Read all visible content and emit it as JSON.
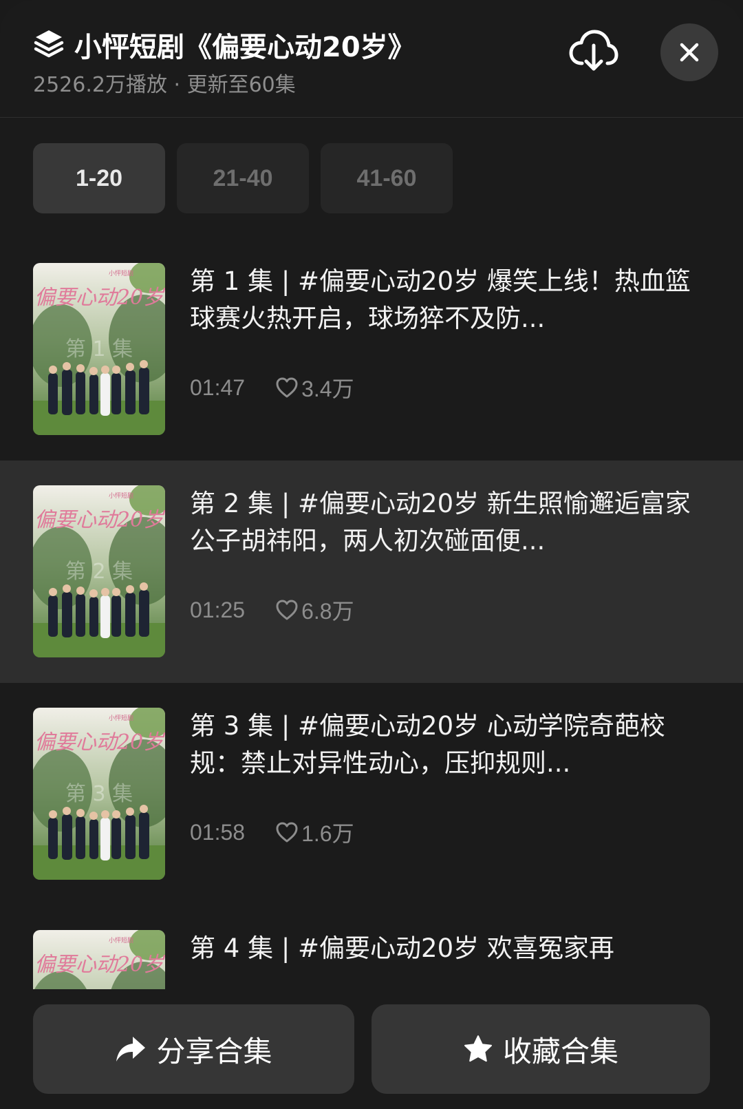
{
  "header": {
    "title": "小怦短剧《偏要心动20岁》",
    "subtitle": "2526.2万播放 · 更新至60集",
    "icons": {
      "collection": "layers-icon",
      "download": "cloud-download-icon",
      "close": "close-icon"
    }
  },
  "tabs": [
    {
      "label": "1-20",
      "active": true
    },
    {
      "label": "21-40",
      "active": false
    },
    {
      "label": "41-60",
      "active": false
    }
  ],
  "thumbnail": {
    "title": "偏要心动20岁",
    "badge": "小怦短剧"
  },
  "episodes": [
    {
      "number": "1",
      "ep_label": "第 1 集",
      "title": "第 1 集 | #偏要心动20岁 爆笑上线！热血篮球赛火热开启，球场猝不及防...",
      "duration": "01:47",
      "likes": "3.4万",
      "playing": false
    },
    {
      "number": "2",
      "ep_label": "第 2 集",
      "title": "第 2 集 | #偏要心动20岁 新生照愉邂逅富家公子胡祎阳，两人初次碰面便...",
      "duration": "01:25",
      "likes": "6.8万",
      "playing": true
    },
    {
      "number": "3",
      "ep_label": "第 3 集",
      "title": "第 3 集 | #偏要心动20岁 心动学院奇葩校规：禁止对异性动心，压抑规则...",
      "duration": "01:58",
      "likes": "1.6万",
      "playing": false
    },
    {
      "number": "4",
      "ep_label": "第 4 集",
      "title": "第 4 集 | #偏要心动20岁  欢喜冤家再",
      "duration": "",
      "likes": "",
      "playing": false
    }
  ],
  "actions": {
    "share_label": "分享合集",
    "favorite_label": "收藏合集"
  },
  "colors": {
    "background": "#1b1b1b",
    "active_row": "#2e2e2e",
    "button": "#363636",
    "muted_text": "#8d8d8d"
  }
}
